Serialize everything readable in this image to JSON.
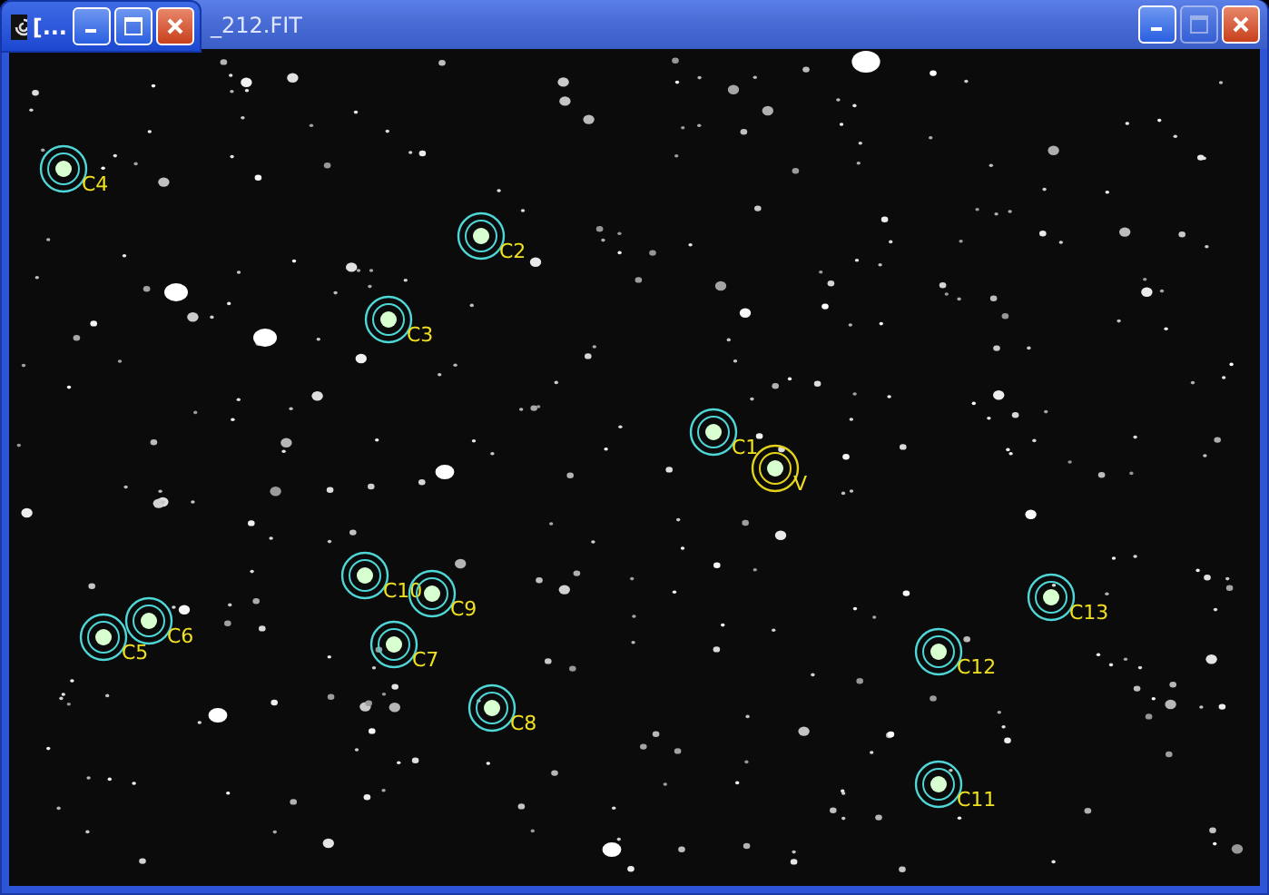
{
  "image_window": {
    "title": "_212.FIT",
    "minimize_enabled": true,
    "maximize_enabled": false
  },
  "small_window": {
    "title": "[...",
    "minimize_enabled": true,
    "maximize_enabled": true
  },
  "markers": [
    {
      "label": "C4",
      "kind": "comparison"
    },
    {
      "label": "C2",
      "kind": "comparison"
    },
    {
      "label": "C3",
      "kind": "comparison"
    },
    {
      "label": "C1",
      "kind": "comparison"
    },
    {
      "label": "V",
      "kind": "variable"
    },
    {
      "label": "C13",
      "kind": "comparison"
    },
    {
      "label": "C10",
      "kind": "comparison"
    },
    {
      "label": "C9",
      "kind": "comparison"
    },
    {
      "label": "C6",
      "kind": "comparison"
    },
    {
      "label": "C5",
      "kind": "comparison"
    },
    {
      "label": "C7",
      "kind": "comparison"
    },
    {
      "label": "C12",
      "kind": "comparison"
    },
    {
      "label": "C8",
      "kind": "comparison"
    },
    {
      "label": "C11",
      "kind": "comparison"
    }
  ]
}
